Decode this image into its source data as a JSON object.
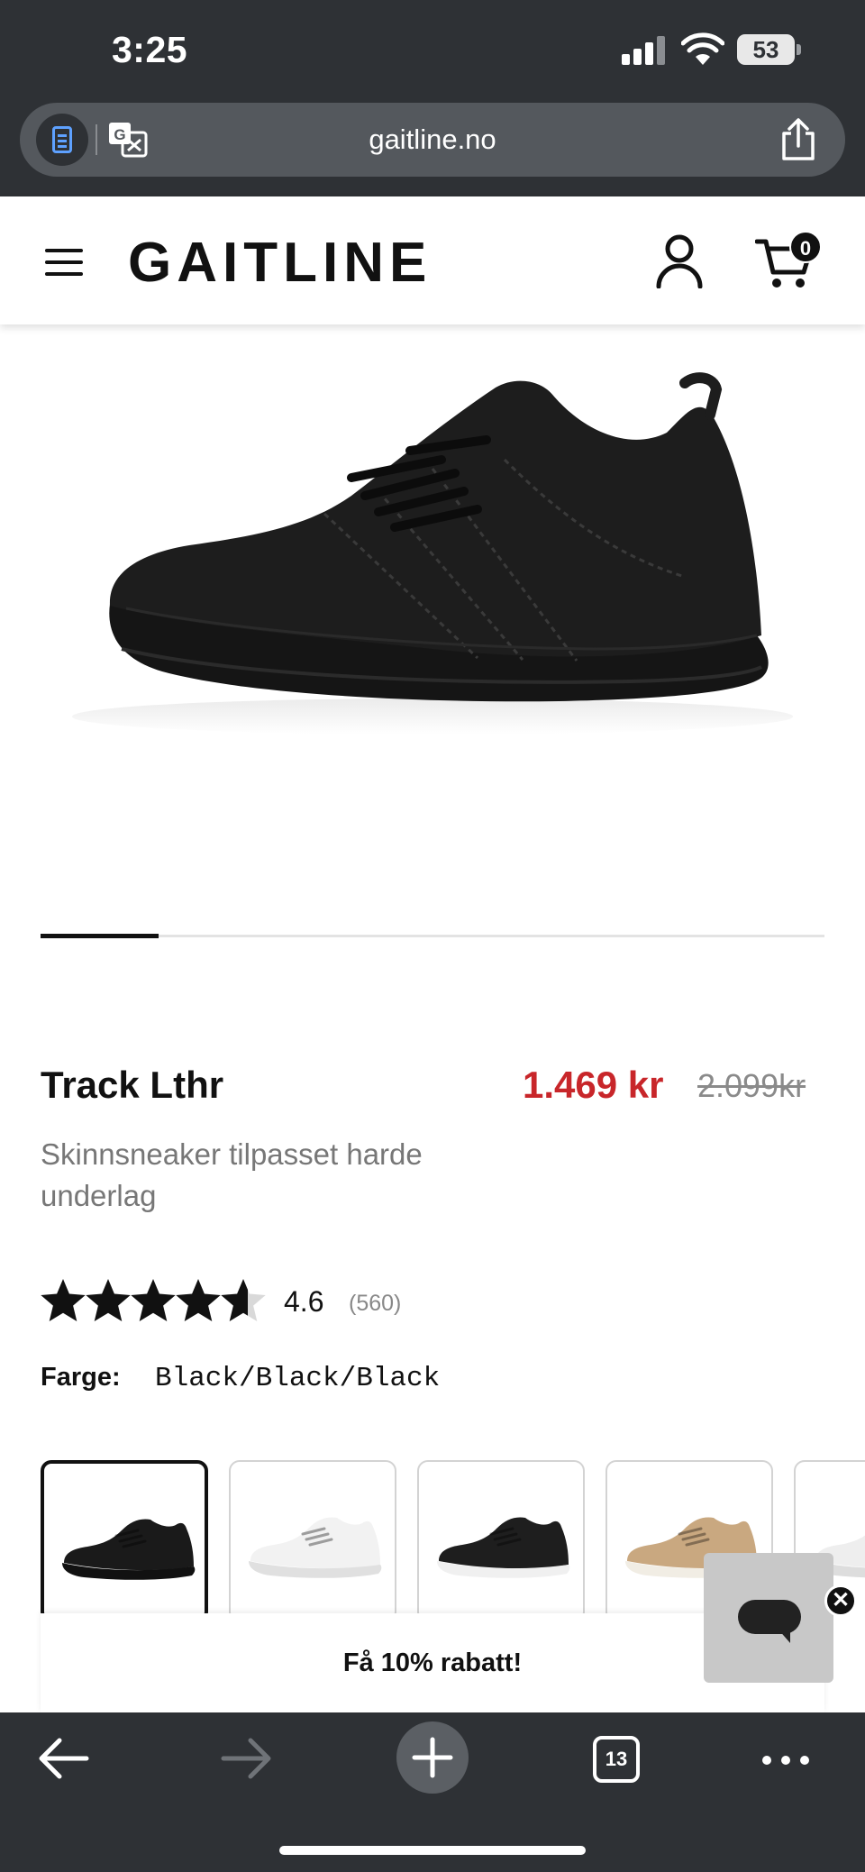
{
  "status_bar": {
    "time": "3:25",
    "battery": "53"
  },
  "browser": {
    "url": "gaitline.no",
    "tab_count": "13"
  },
  "header": {
    "logo": "GAITLINE",
    "cart_count": "0"
  },
  "gallery": {
    "progress_fraction": 0.15
  },
  "product": {
    "name": "Track Lthr",
    "price": "1.469 kr",
    "old_price": "2.099kr",
    "subtitle": "Skinnsneaker tilpasset harde underlag",
    "rating": "4.6",
    "rating_value": 4.6,
    "rating_count": "(560)",
    "color_label": "Farge:",
    "color_value": "Black/Black/Black"
  },
  "swatches": [
    {
      "color": "#1a1a1a",
      "sole": "#111111",
      "selected": true
    },
    {
      "color": "#f2f2f2",
      "sole": "#e0e0e0",
      "selected": false
    },
    {
      "color": "#1e1e1e",
      "sole": "#f0f0f0",
      "selected": false
    },
    {
      "color": "#c9a880",
      "sole": "#f1ede4",
      "selected": false
    },
    {
      "color": "#eeeeee",
      "sole": "#dddddd",
      "selected": false
    }
  ],
  "promo": {
    "label": "Få 10% rabatt!"
  },
  "colors": {
    "sale": "#c8262a",
    "browser_chrome": "#2e3135"
  }
}
